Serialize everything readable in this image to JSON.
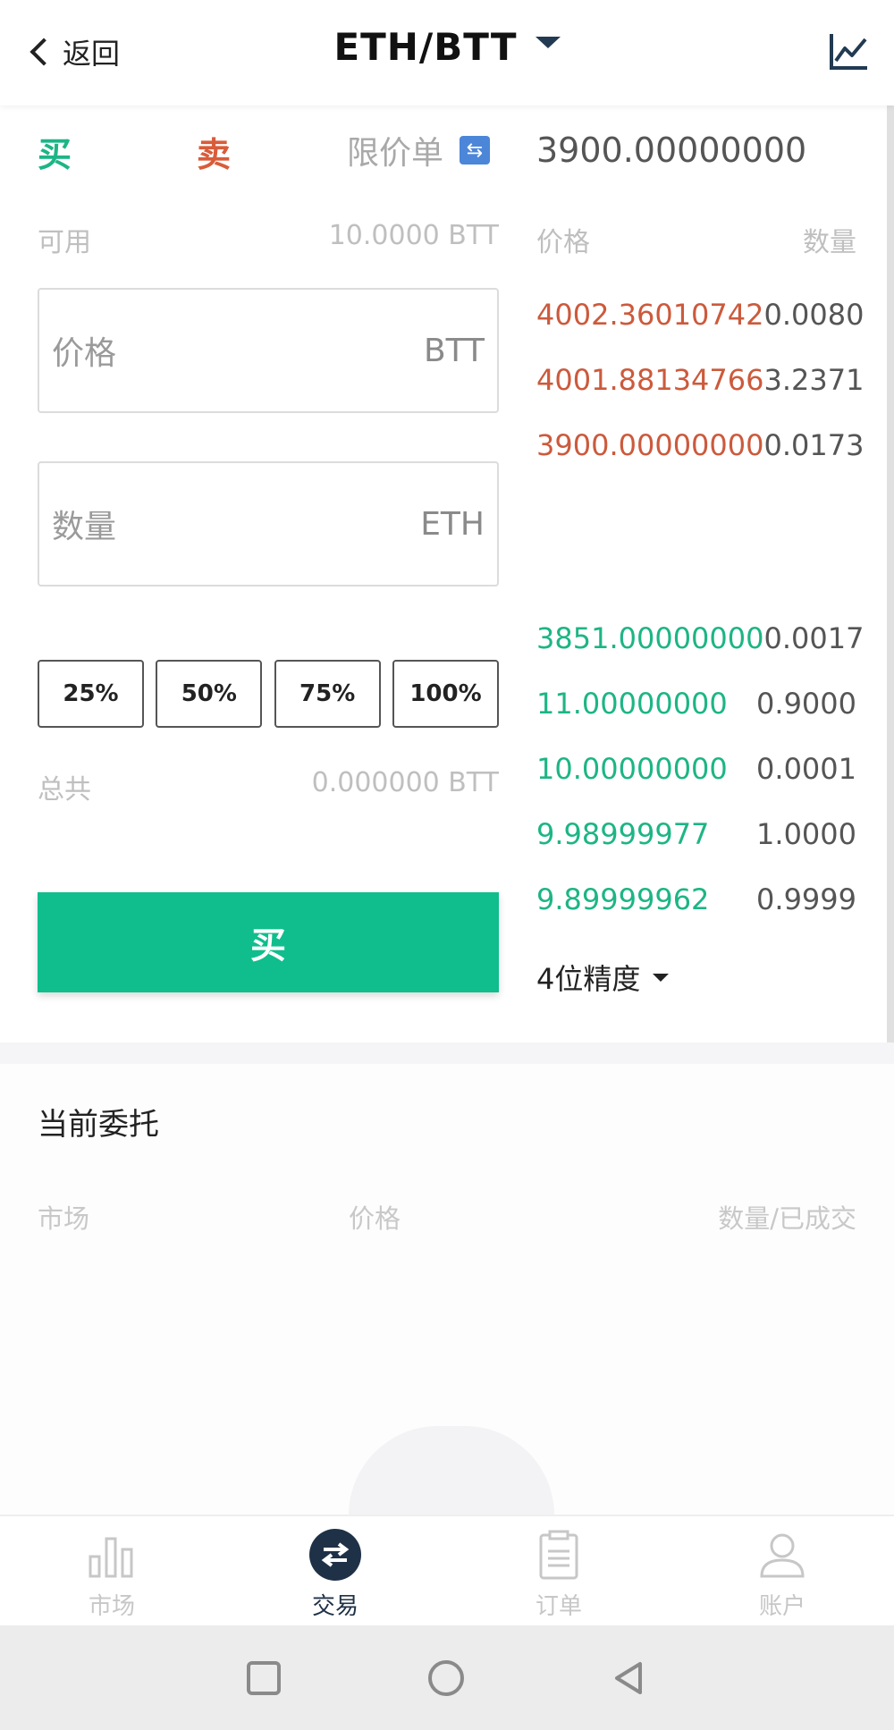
{
  "header": {
    "back_label": "返回",
    "pair": "ETH/BTT"
  },
  "trade": {
    "buy_tab": "买",
    "sell_tab": "卖",
    "order_type": "限价单",
    "available_label": "可用",
    "available_value": "10.0000 BTT",
    "price_placeholder": "价格",
    "price_unit": "BTT",
    "qty_placeholder": "数量",
    "qty_unit": "ETH",
    "percent_buttons": [
      "25%",
      "50%",
      "75%",
      "100%"
    ],
    "total_label": "总共",
    "total_value": "0.000000 BTT",
    "buy_button": "买"
  },
  "order_book": {
    "last_price": "3900.00000000",
    "price_header": "价格",
    "qty_header": "数量",
    "asks": [
      {
        "price": "4002.36010742",
        "qty": "0.0080"
      },
      {
        "price": "4001.88134766",
        "qty": "3.2371"
      },
      {
        "price": "3900.00000000",
        "qty": "0.0173"
      }
    ],
    "bids": [
      {
        "price": "3851.00000000",
        "qty": "0.0017"
      },
      {
        "price": "11.00000000",
        "qty": "0.9000"
      },
      {
        "price": "10.00000000",
        "qty": "0.0001"
      },
      {
        "price": "9.98999977",
        "qty": "1.0000"
      },
      {
        "price": "9.89999962",
        "qty": "0.9999"
      }
    ],
    "precision": "4位精度",
    "ask_color": "#cc5a3c",
    "bid_color": "#1db585"
  },
  "orders": {
    "title": "当前委托",
    "col_market": "市场",
    "col_price": "价格",
    "col_qty": "数量/已成交"
  },
  "tabbar": {
    "items": [
      {
        "label": "市场",
        "icon": "bar-chart-icon"
      },
      {
        "label": "交易",
        "icon": "swap-icon"
      },
      {
        "label": "订单",
        "icon": "clipboard-icon"
      },
      {
        "label": "账户",
        "icon": "user-icon"
      }
    ],
    "active_color": "#1f3146"
  },
  "colors": {
    "buy_green": "#0fbe8c",
    "sell_red": "#d95c3a",
    "badge_blue": "#4b86d8"
  }
}
